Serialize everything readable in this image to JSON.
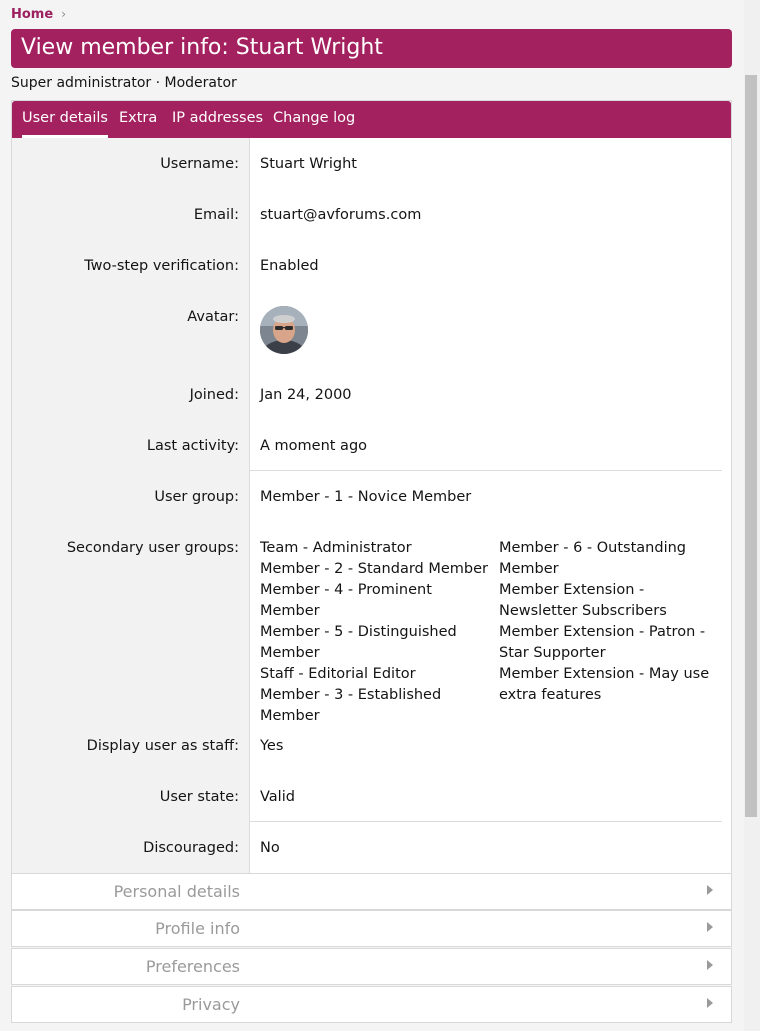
{
  "breadcrumb": {
    "home": "Home"
  },
  "page": {
    "title": "View member info: Stuart Wright",
    "subtitle": "Super administrator · Moderator"
  },
  "tabs": [
    "User details",
    "Extra",
    "IP addresses",
    "Change log"
  ],
  "details": {
    "username_label": "Username:",
    "username": "Stuart Wright",
    "email_label": "Email:",
    "email": "stuart@avforums.com",
    "twostep_label": "Two-step verification:",
    "twostep": "Enabled",
    "avatar_label": "Avatar:",
    "joined_label": "Joined:",
    "joined": "Jan 24, 2000",
    "last_activity_label": "Last activity:",
    "last_activity": "A moment ago",
    "user_group_label": "User group:",
    "user_group": "Member - 1 - Novice Member",
    "secondary_label": "Secondary user groups:",
    "secondary_groups": [
      "Team - Administrator",
      "Member - 2 - Standard Member",
      "Member - 4 - Prominent Member",
      "Member - 5 - Distinguished Member",
      "Staff - Editorial Editor",
      "Member - 3 - Established Member",
      "Member - 6 - Outstanding Member",
      "Member Extension - Newsletter Subscribers",
      "Member Extension - Patron - Star Supporter",
      "Member Extension - May use extra features"
    ],
    "display_staff_label": "Display user as staff:",
    "display_staff": "Yes",
    "user_state_label": "User state:",
    "user_state": "Valid",
    "discouraged_label": "Discouraged:",
    "discouraged": "No"
  },
  "sections": [
    "Personal details",
    "Profile info",
    "Preferences",
    "Privacy"
  ],
  "colors": {
    "accent": "#a3215f",
    "link": "#9c1f5f"
  }
}
